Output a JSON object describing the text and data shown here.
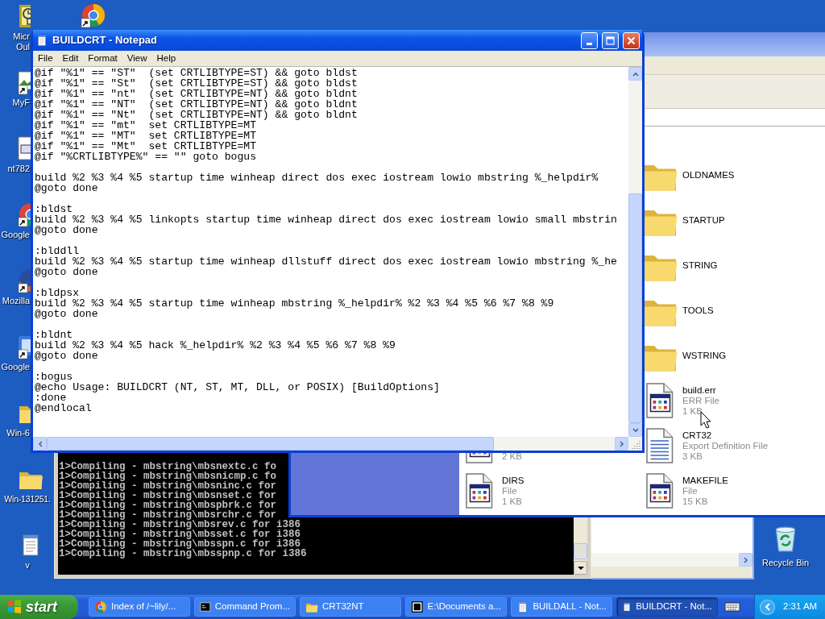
{
  "desktop_icons": [
    {
      "kind": "clock-app",
      "label_lines": [
        "Micr",
        "Oul"
      ],
      "covered": true,
      "shortcut": false
    },
    {
      "kind": "picture-doc",
      "label_lines": [
        "MyF"
      ],
      "covered": true,
      "shortcut": true
    },
    {
      "kind": "document",
      "label_lines": [
        "nt782"
      ],
      "covered": true,
      "shortcut": false
    },
    {
      "kind": "round-logo",
      "label_lines": [
        "Google"
      ],
      "covered": true,
      "shortcut": true
    },
    {
      "kind": "globe",
      "label_lines": [
        "Mozilla"
      ],
      "covered": true,
      "shortcut": true
    },
    {
      "kind": "square-app",
      "label_lines": [
        "Google"
      ],
      "covered": true,
      "shortcut": true
    },
    {
      "kind": "folder",
      "label_lines": [
        "Win-6"
      ],
      "covered": true,
      "shortcut": false
    },
    {
      "kind": "folder",
      "label_lines": [
        "Win-131251."
      ],
      "covered": false,
      "shortcut": false
    },
    {
      "kind": "notepad",
      "label_lines": [
        "v"
      ],
      "covered": false,
      "shortcut": false
    }
  ],
  "notepad": {
    "title": "BUILDCRT - Notepad",
    "menu": [
      "File",
      "Edit",
      "Format",
      "View",
      "Help"
    ],
    "blocks": [
      [
        "@if \"%1\" == \"ST\"  (set CRTLIBTYPE=ST) && goto bldst",
        "@if \"%1\" == \"St\"  (set CRTLIBTYPE=ST) && goto bldst",
        "@if \"%1\" == \"nt\"  (set CRTLIBTYPE=NT) && goto bldnt",
        "@if \"%1\" == \"NT\"  (set CRTLIBTYPE=NT) && goto bldnt",
        "@if \"%1\" == \"Nt\"  (set CRTLIBTYPE=NT) && goto bldnt",
        "@if \"%1\" == \"mt\"  set CRTLIBTYPE=MT",
        "@if \"%1\" == \"MT\"  set CRTLIBTYPE=MT",
        "@if \"%1\" == \"Mt\"  set CRTLIBTYPE=MT",
        "@if \"%CRTLIBTYPE%\" == \"\" goto bogus"
      ],
      [
        "build %2 %3 %4 %5 startup time winheap direct dos exec iostream lowio mbstring %_helpdir%",
        "@goto done"
      ],
      [
        ":bldst",
        "build %2 %3 %4 %5 linkopts startup time winheap direct dos exec iostream lowio small mbstrin",
        "@goto done"
      ],
      [
        ":blddll",
        "build %2 %3 %4 %5 startup time winheap dllstuff direct dos exec iostream lowio mbstring %_he",
        "@goto done"
      ],
      [
        ":bldpsx",
        "build %2 %3 %4 %5 startup time winheap mbstring %_helpdir% %2 %3 %4 %5 %6 %7 %8 %9",
        "@goto done"
      ],
      [
        ":bldnt",
        "build %2 %3 %4 %5 hack %_helpdir% %2 %3 %4 %5 %6 %7 %8 %9",
        "@goto done"
      ],
      [
        ":bogus",
        "@echo Usage: BUILDCRT (NT, ST, MT, DLL, or POSIX) [BuildOptions]",
        ":done",
        "@endlocal"
      ]
    ]
  },
  "explorer": {
    "left_items": [
      {
        "kind": "app-file",
        "size": "2 KB"
      },
      {
        "kind": "app-file",
        "name": "DIRS",
        "type": "File",
        "size": "1 KB"
      }
    ],
    "right_items": [
      {
        "kind": "folder",
        "name": "OLDNAMES"
      },
      {
        "kind": "folder",
        "name": "STARTUP"
      },
      {
        "kind": "folder",
        "name": "STRING"
      },
      {
        "kind": "folder",
        "name": "TOOLS"
      },
      {
        "kind": "folder",
        "name": "WSTRING"
      },
      {
        "kind": "app-file",
        "name": "build.err",
        "type": "ERR File",
        "size": "1 KB"
      },
      {
        "kind": "def-file",
        "name": "CRT32",
        "type": "Export Definition File",
        "size": "3 KB"
      },
      {
        "kind": "app-file",
        "name": "MAKEFILE",
        "type": "File",
        "size": "15 KB"
      }
    ]
  },
  "console": {
    "lines": [
      "1>Compiling - mbstring\\mbsnextc.c fo",
      "1>Compiling - mbstring\\mbsnicmp.c fo",
      "1>Compiling - mbstring\\mbsninc.c for",
      "1>Compiling - mbstring\\mbsnset.c for",
      "1>Compiling - mbstring\\mbspbrk.c for",
      "1>Compiling - mbstring\\mbsrchr.c for",
      "1>Compiling - mbstring\\mbsrev.c for i386",
      "1>Compiling - mbstring\\mbsset.c for i386",
      "1>Compiling - mbstring\\mbsspn.c for i386",
      "1>Compiling - mbstring\\mbsspnp.c for i386"
    ]
  },
  "recycle_bin": {
    "label": "Recycle Bin"
  },
  "taskbar": {
    "start": "start",
    "tasks": [
      {
        "kind": "browser",
        "label": "Index of /~lily/...",
        "selected": false
      },
      {
        "kind": "console",
        "label": "Command Prom...",
        "selected": false
      },
      {
        "kind": "folder",
        "label": "CRT32NT",
        "selected": false
      },
      {
        "kind": "archive",
        "label": "E:\\Documents a...",
        "selected": false
      },
      {
        "kind": "notepad",
        "label": "BUILDALL - Not...",
        "selected": false
      },
      {
        "kind": "notepad",
        "label": "BUILDCRT - Not...",
        "selected": true
      }
    ],
    "clock": "2:31 AM"
  }
}
